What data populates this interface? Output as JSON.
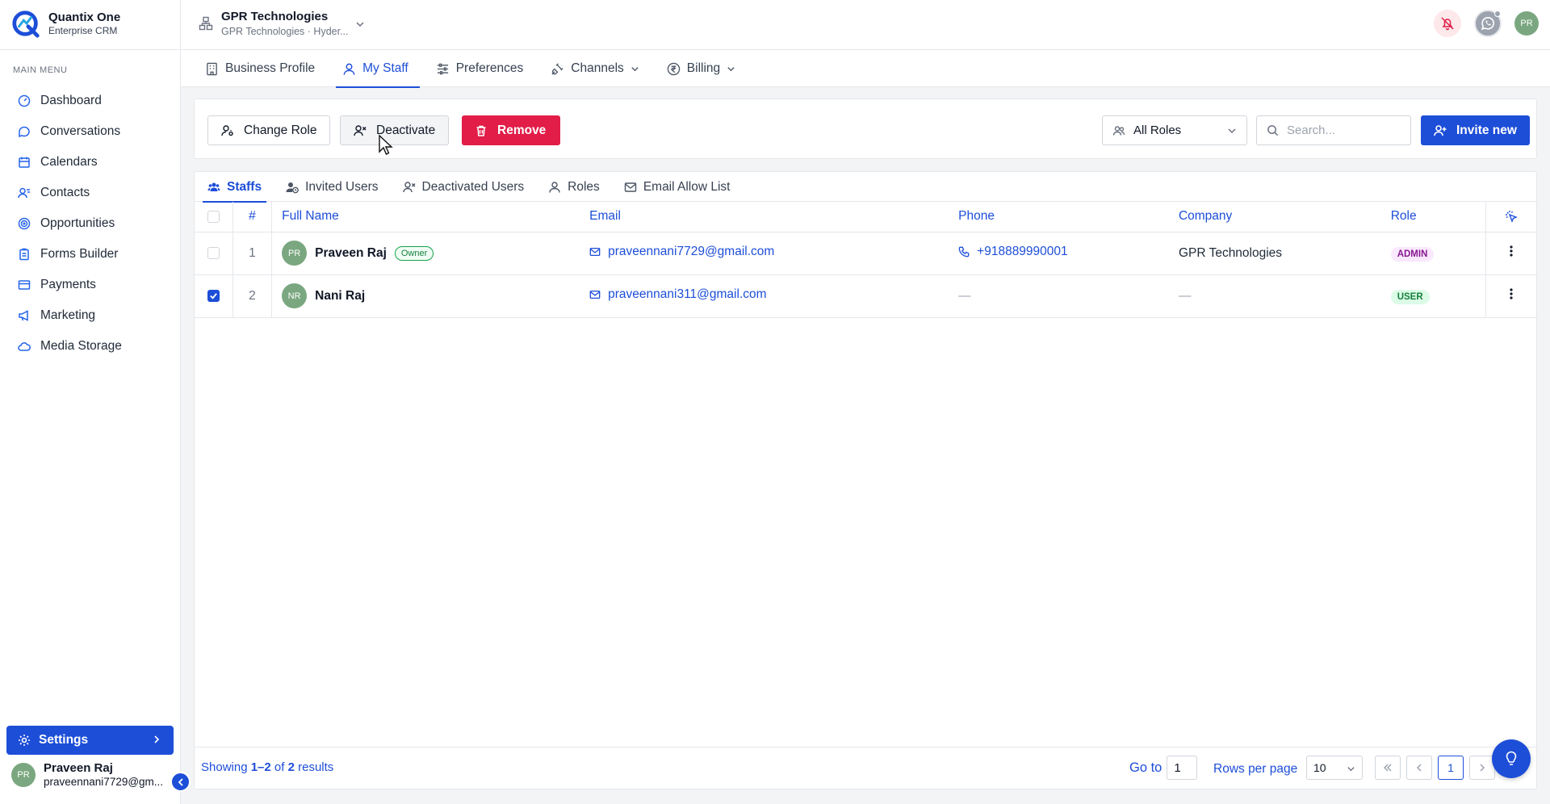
{
  "app": {
    "name": "Quantix One",
    "subtitle": "Enterprise CRM"
  },
  "sidebar": {
    "section_label": "MAIN MENU",
    "items": [
      {
        "label": "Dashboard",
        "icon": "gauge-icon"
      },
      {
        "label": "Conversations",
        "icon": "chat-icon"
      },
      {
        "label": "Calendars",
        "icon": "calendar-icon"
      },
      {
        "label": "Contacts",
        "icon": "contacts-icon"
      },
      {
        "label": "Opportunities",
        "icon": "target-icon"
      },
      {
        "label": "Forms Builder",
        "icon": "clipboard-icon"
      },
      {
        "label": "Payments",
        "icon": "card-icon"
      },
      {
        "label": "Marketing",
        "icon": "megaphone-icon"
      },
      {
        "label": "Media Storage",
        "icon": "cloud-icon"
      }
    ],
    "settings_label": "Settings",
    "user": {
      "initials": "PR",
      "name": "Praveen Raj",
      "email": "praveennani7729@gm..."
    }
  },
  "topbar": {
    "org_name": "GPR Technologies",
    "org_sub": "GPR Technologies · Hyder...",
    "avatar_initials": "PR"
  },
  "subnav": {
    "items": [
      {
        "label": "Business Profile",
        "active": false
      },
      {
        "label": "My Staff",
        "active": true
      },
      {
        "label": "Preferences",
        "active": false
      },
      {
        "label": "Channels",
        "active": false,
        "dropdown": true
      },
      {
        "label": "Billing",
        "active": false,
        "dropdown": true
      }
    ]
  },
  "toolbar": {
    "change_role_label": "Change Role",
    "deactivate_label": "Deactivate",
    "remove_label": "Remove",
    "role_filter_value": "All Roles",
    "search_placeholder": "Search...",
    "invite_label": "Invite new"
  },
  "tabs": [
    {
      "label": "Staffs",
      "active": true
    },
    {
      "label": "Invited Users",
      "active": false
    },
    {
      "label": "Deactivated Users",
      "active": false
    },
    {
      "label": "Roles",
      "active": false
    },
    {
      "label": "Email Allow List",
      "active": false
    }
  ],
  "table": {
    "headers": {
      "num": "#",
      "name": "Full Name",
      "email": "Email",
      "phone": "Phone",
      "company": "Company",
      "role": "Role"
    },
    "rows": [
      {
        "num": "1",
        "initials": "PR",
        "name": "Praveen Raj",
        "badge": "Owner",
        "email": "praveennani7729@gmail.com",
        "phone": "+918889990001",
        "company": "GPR Technologies",
        "role": "ADMIN",
        "checked": false
      },
      {
        "num": "2",
        "initials": "NR",
        "name": "Nani Raj",
        "badge": "",
        "email": "praveennani311@gmail.com",
        "phone": "—",
        "company": "—",
        "role": "USER",
        "checked": true
      }
    ]
  },
  "footer": {
    "showing_prefix": "Showing ",
    "showing_range": "1–2",
    "showing_of": " of ",
    "showing_total": "2",
    "showing_suffix": " results",
    "goto_label": "Go to",
    "goto_value": "1",
    "rows_per_page_label": "Rows per page",
    "rows_per_page_value": "10",
    "current_page": "1"
  },
  "colors": {
    "primary": "#1d4ed8",
    "danger": "#e11d48",
    "avatar": "#7aa77f"
  }
}
